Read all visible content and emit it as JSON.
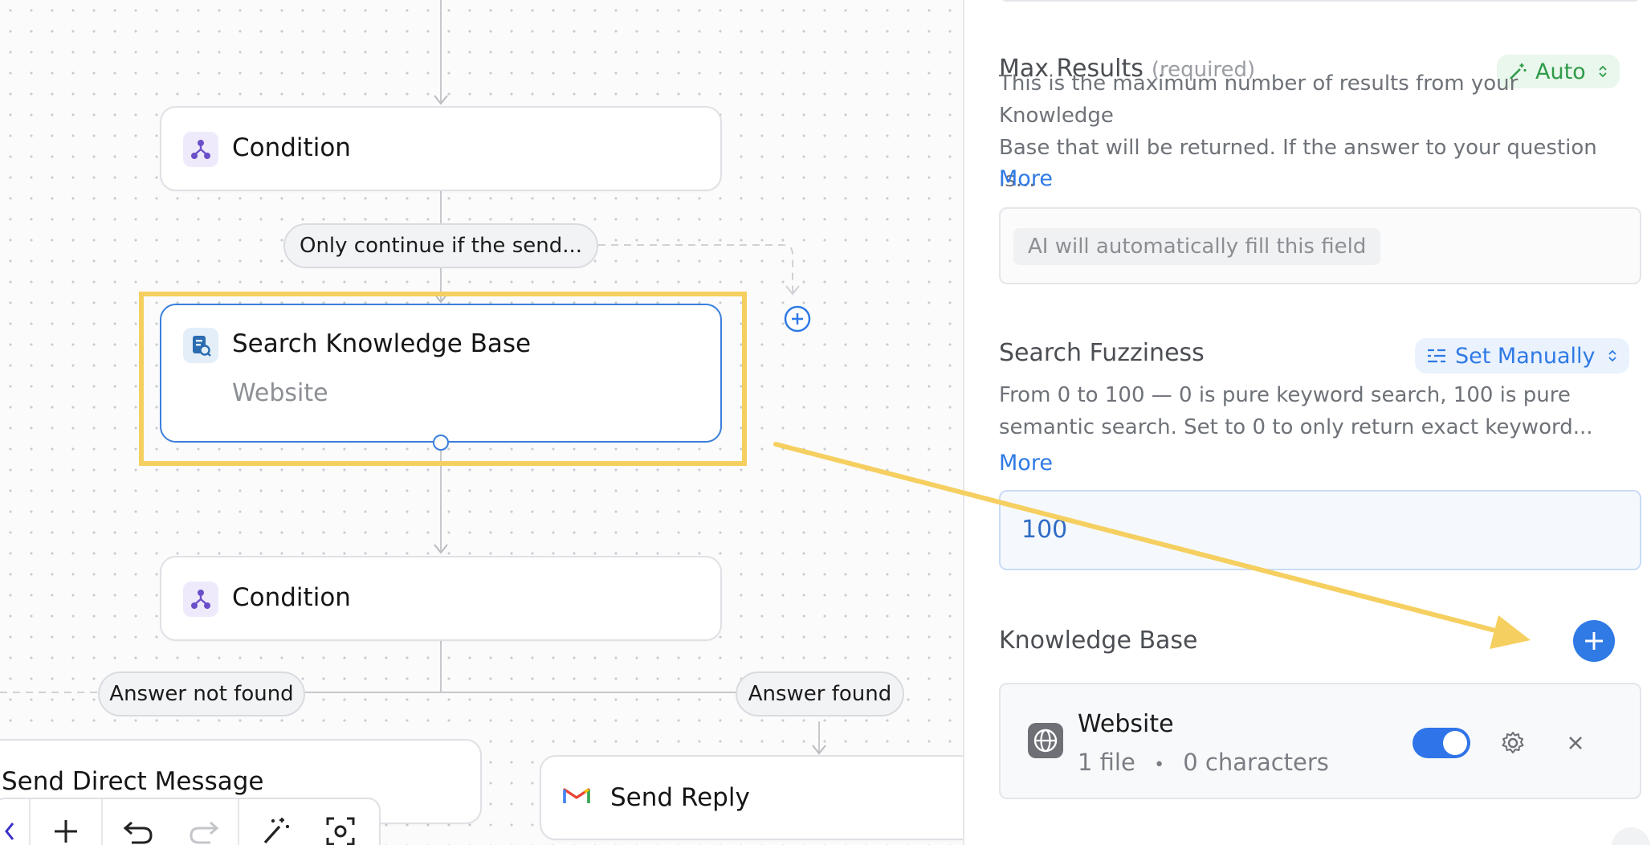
{
  "canvas": {
    "nodes": {
      "condition_1": {
        "title": "Condition"
      },
      "search_kb": {
        "title": "Search Knowledge Base",
        "subtitle": "Website"
      },
      "condition_2": {
        "title": "Condition"
      },
      "send_direct_message": {
        "title": "Send Direct Message"
      },
      "send_reply": {
        "title": "Send Reply"
      }
    },
    "pills": {
      "only_continue": "Only continue if the send...",
      "answer_not_found": "Answer not found",
      "answer_found": "Answer found"
    },
    "colors": {
      "highlight": "#f5cf60",
      "accent": "#2f7ae5",
      "condition_icon": "#6b4fc8"
    }
  },
  "panel": {
    "max_results": {
      "title": "Max Results",
      "required": "(required)",
      "mode": "Auto",
      "description_line1": "This is the maximum number of results from your Knowledge",
      "description_line2": "Base that will be returned. If the answer to your question is...",
      "more": "More",
      "auto_fill_text": "AI will automatically fill this field"
    },
    "search_fuzziness": {
      "title": "Search Fuzziness",
      "mode": "Set Manually",
      "description_line1": "From 0 to 100 — 0 is pure keyword search, 100 is pure",
      "description_line2": "semantic search. Set to 0 to only return exact keyword...",
      "more": "More",
      "value": "100"
    },
    "knowledge_base": {
      "title": "Knowledge Base",
      "item": {
        "name": "Website",
        "files": "1 file",
        "separator": "•",
        "characters": "0 characters",
        "enabled": true
      }
    }
  }
}
